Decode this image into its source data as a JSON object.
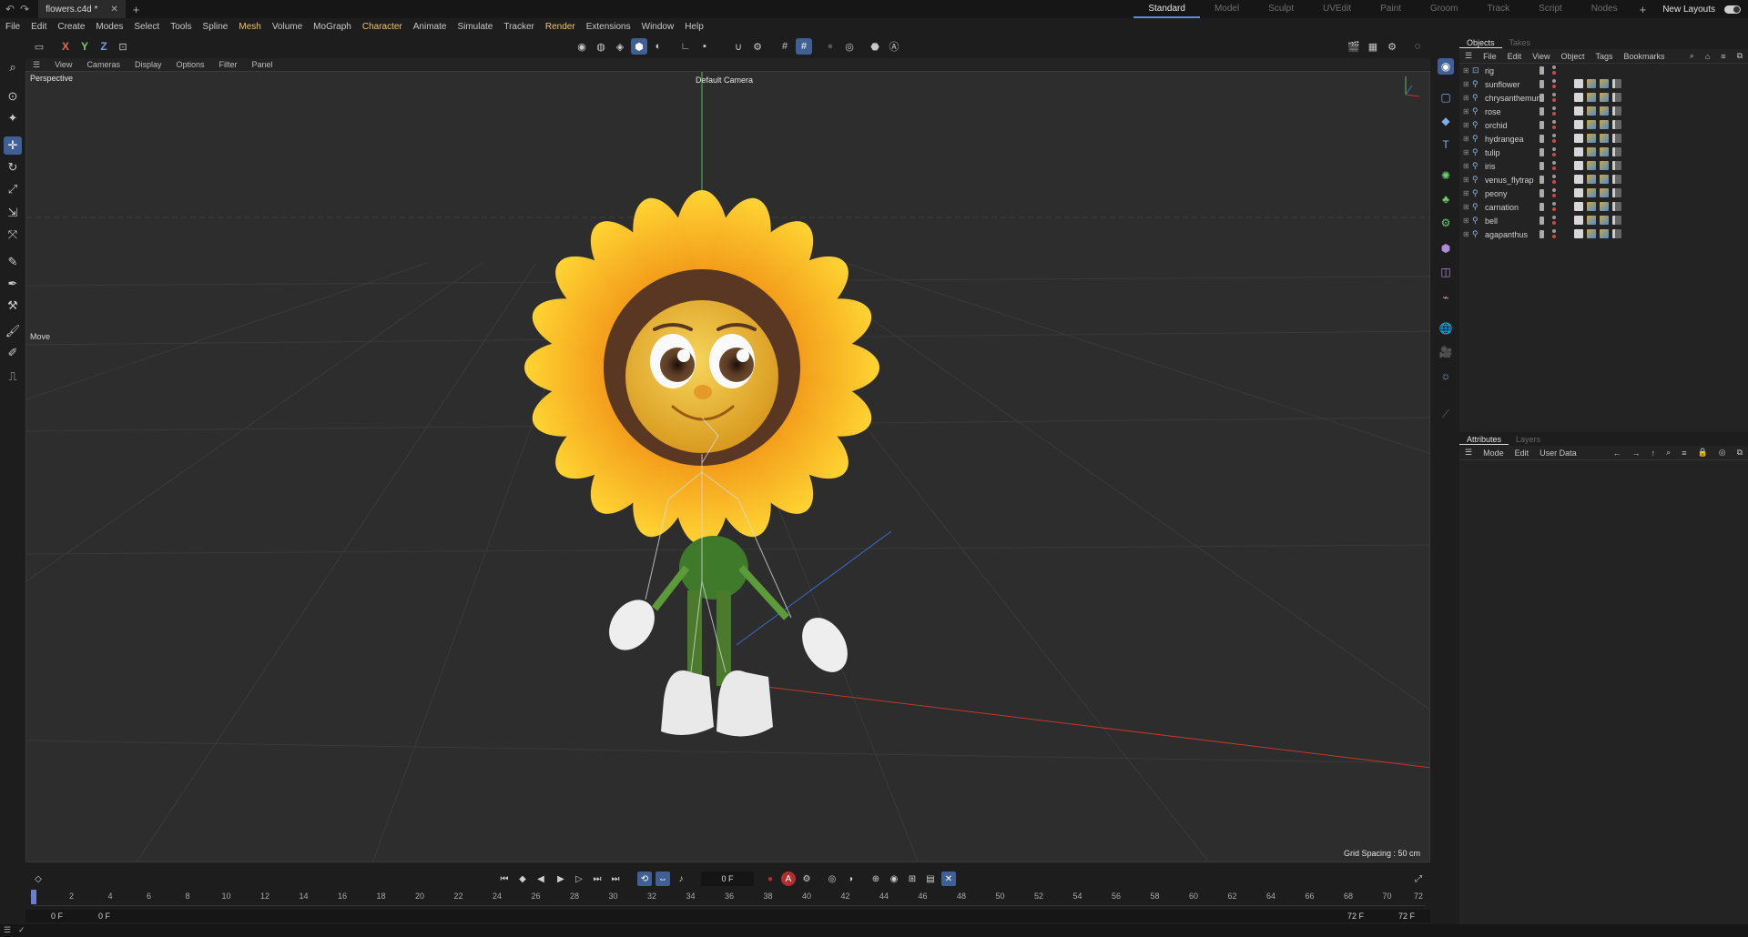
{
  "window": {
    "doc_tab": "flowers.c4d *",
    "layouts": [
      "Standard",
      "Model",
      "Sculpt",
      "UVEdit",
      "Paint",
      "Groom",
      "Track",
      "Script",
      "Nodes"
    ],
    "active_layout": "Standard",
    "new_layouts": "New Layouts"
  },
  "menu": [
    {
      "label": "File",
      "hl": false
    },
    {
      "label": "Edit",
      "hl": false
    },
    {
      "label": "Create",
      "hl": false
    },
    {
      "label": "Modes",
      "hl": false
    },
    {
      "label": "Select",
      "hl": false
    },
    {
      "label": "Tools",
      "hl": false
    },
    {
      "label": "Spline",
      "hl": false
    },
    {
      "label": "Mesh",
      "hl": true
    },
    {
      "label": "Volume",
      "hl": false
    },
    {
      "label": "MoGraph",
      "hl": false
    },
    {
      "label": "Character",
      "hl": true
    },
    {
      "label": "Animate",
      "hl": false
    },
    {
      "label": "Simulate",
      "hl": false
    },
    {
      "label": "Tracker",
      "hl": false
    },
    {
      "label": "Render",
      "hl": true
    },
    {
      "label": "Extensions",
      "hl": false
    },
    {
      "label": "Window",
      "hl": false
    },
    {
      "label": "Help",
      "hl": false
    }
  ],
  "toolbar": {
    "axis_x": "X",
    "axis_y": "Y",
    "axis_z": "Z"
  },
  "viewport": {
    "menu": [
      "View",
      "Cameras",
      "Display",
      "Options",
      "Filter",
      "Panel"
    ],
    "projection": "Perspective",
    "camera": "Default Camera",
    "grid_spacing": "Grid Spacing : 50 cm",
    "tool": "Move"
  },
  "timeline": {
    "current_frame": "0 F",
    "ticks": [
      "0",
      "2",
      "4",
      "6",
      "8",
      "10",
      "12",
      "14",
      "16",
      "18",
      "20",
      "22",
      "24",
      "26",
      "28",
      "30",
      "32",
      "34",
      "36",
      "38",
      "40",
      "42",
      "44",
      "46",
      "48",
      "50",
      "52",
      "54",
      "56",
      "58",
      "60",
      "62",
      "64",
      "66",
      "68",
      "70",
      "72"
    ],
    "range_start": "0 F",
    "preview_start": "0 F",
    "preview_end": "72 F",
    "range_end": "72 F"
  },
  "objects_panel": {
    "tabs": [
      "Objects",
      "Takes"
    ],
    "menu": [
      "File",
      "Edit",
      "View",
      "Object",
      "Tags",
      "Bookmarks"
    ],
    "items": [
      "rig",
      "sunflower",
      "chrysanthemum",
      "rose",
      "orchid",
      "hydrangea",
      "tulip",
      "iris",
      "venus_flytrap",
      "peony",
      "carnation",
      "bell",
      "agapanthus"
    ]
  },
  "attributes_panel": {
    "tabs": [
      "Attributes",
      "Layers"
    ],
    "menu": [
      "Mode",
      "Edit",
      "User Data"
    ]
  },
  "colors": {
    "accent": "#3f5f95",
    "highlight_menu": "#f0c36a",
    "axis_x": "#c0392b",
    "axis_y": "#2e9e3a",
    "axis_z": "#3a6fd1"
  }
}
